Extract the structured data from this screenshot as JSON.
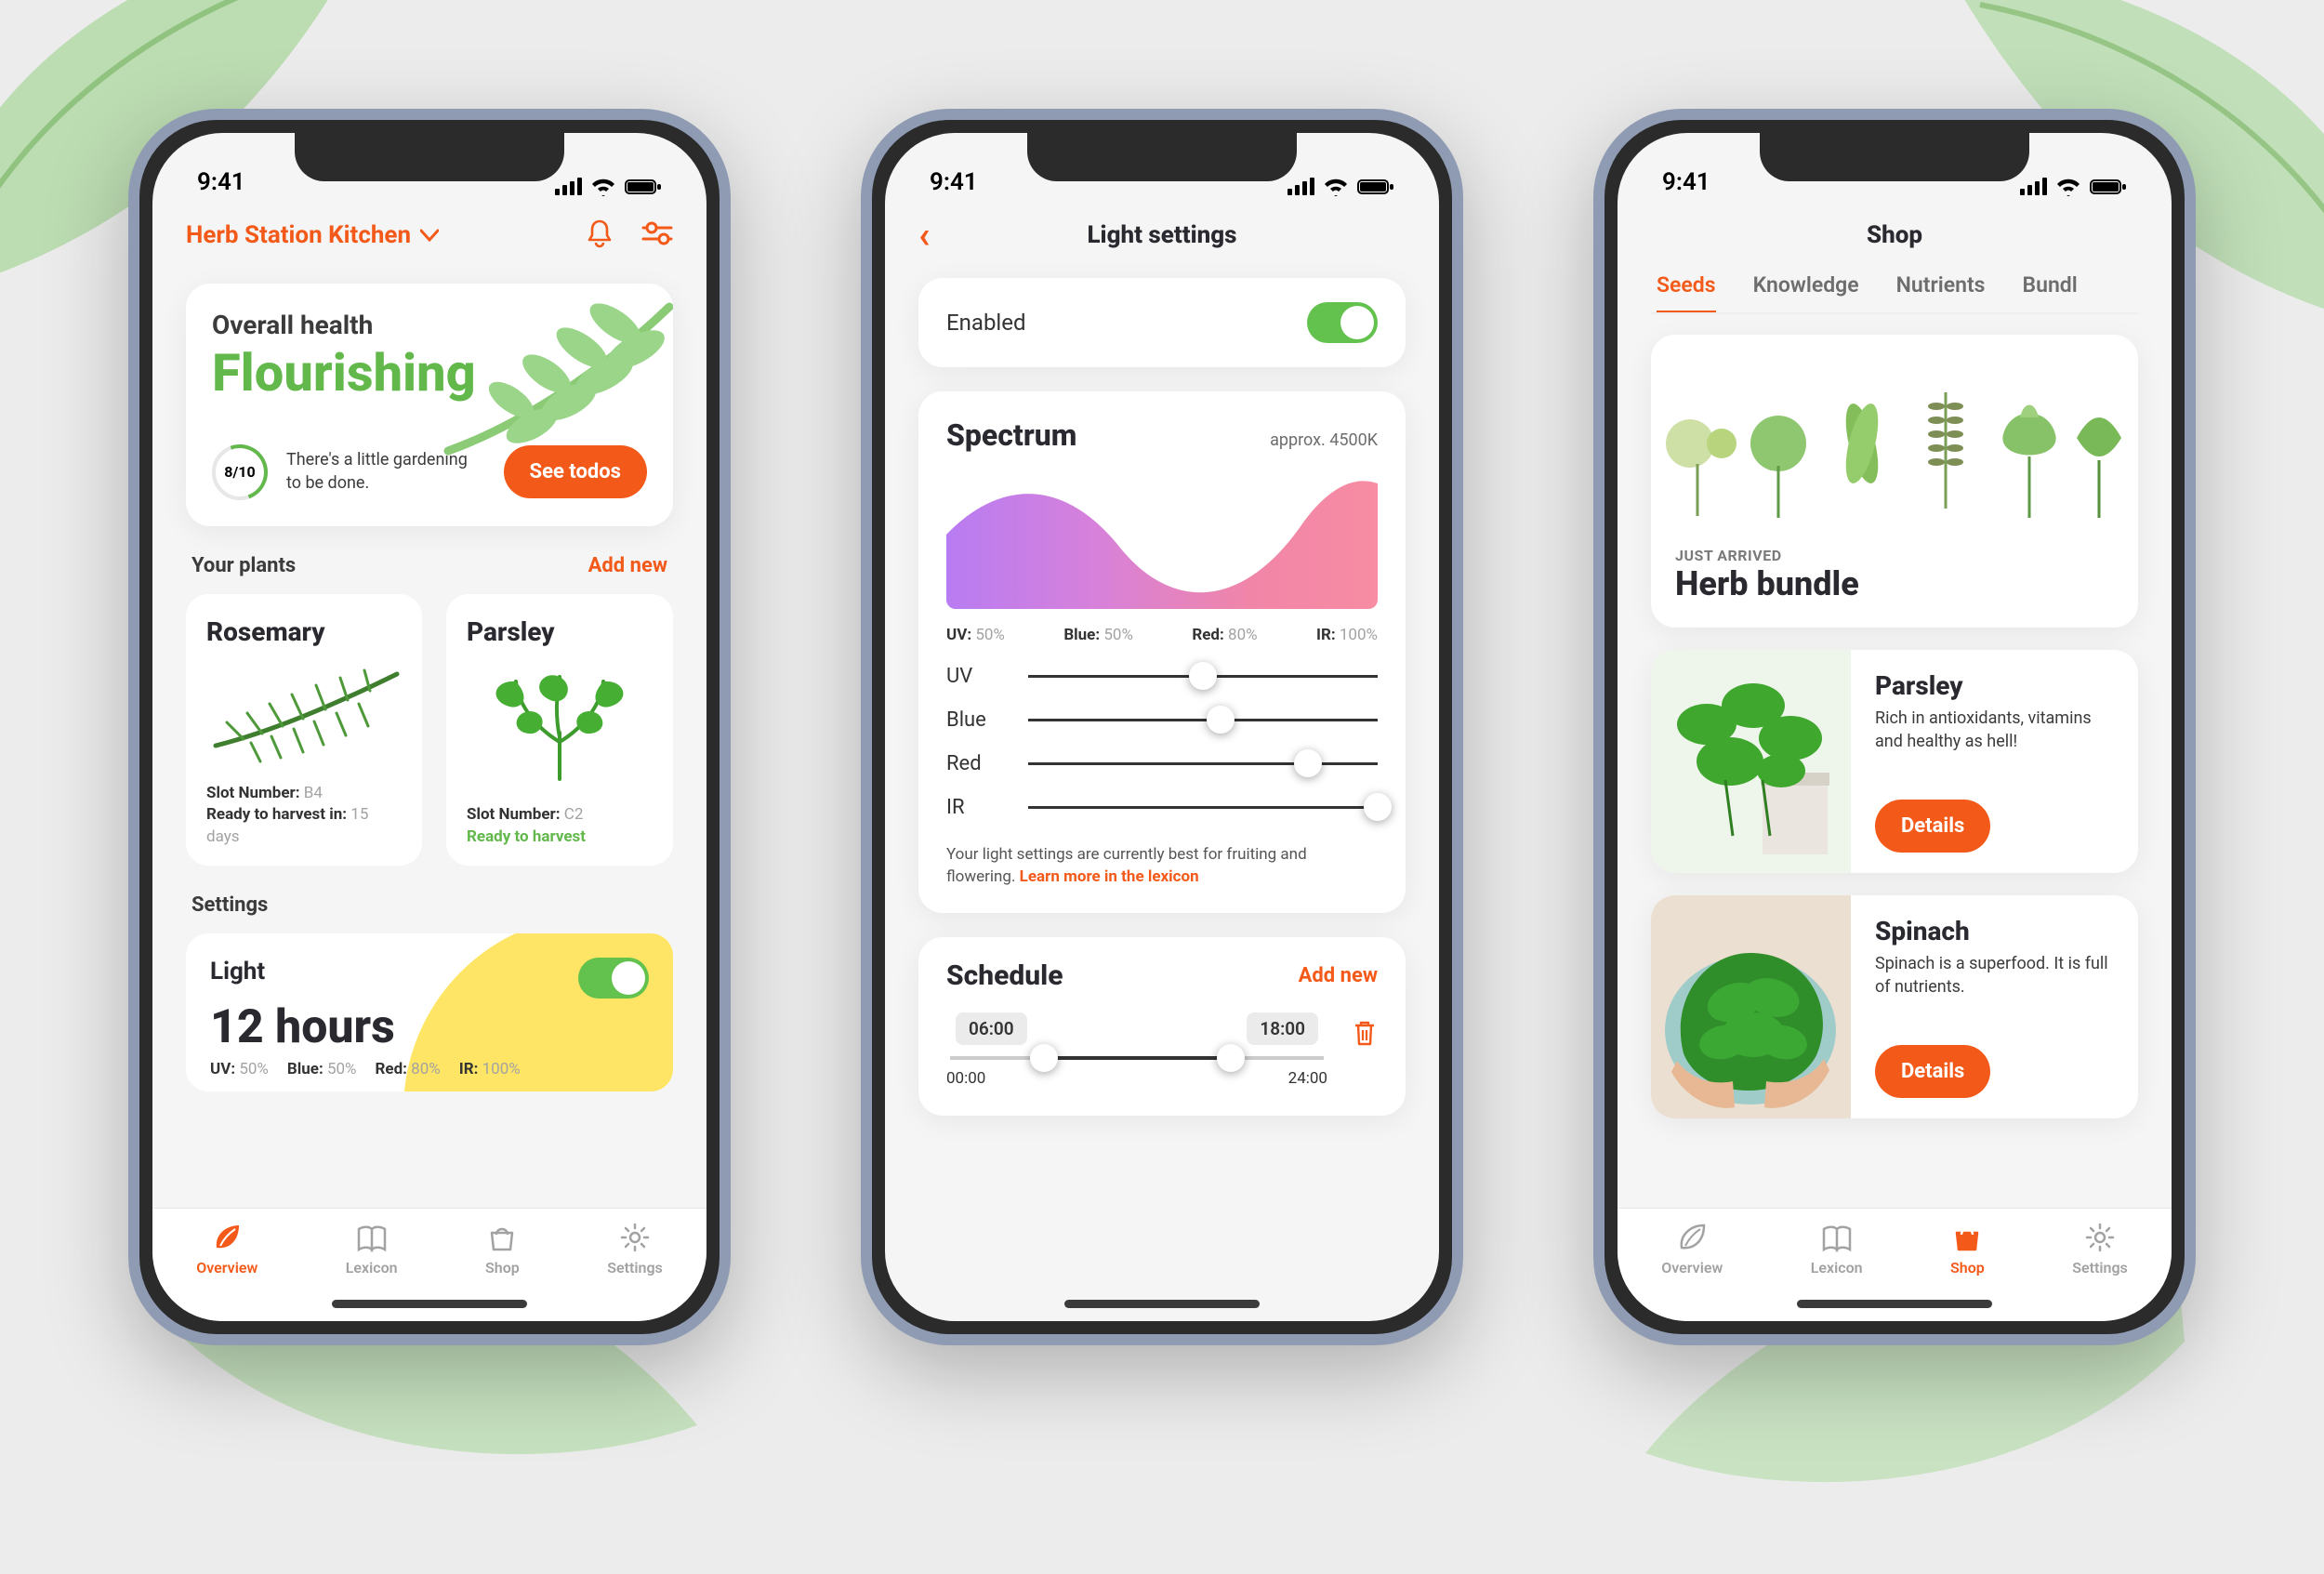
{
  "status": {
    "time": "9:41"
  },
  "screen1": {
    "station_title": "Herb Station Kitchen",
    "health": {
      "label": "Overall health",
      "status": "Flourishing",
      "score": "8/10",
      "tip": "There's a little gardening to be done.",
      "cta": "See todos"
    },
    "plants_section": {
      "title": "Your plants",
      "link": "Add new"
    },
    "plants": [
      {
        "name": "Rosemary",
        "slot_label": "Slot Number:",
        "slot_value": "B4",
        "harvest_label": "Ready to harvest in:",
        "harvest_value": "15 days"
      },
      {
        "name": "Parsley",
        "slot_label": "Slot Number:",
        "slot_value": "C2",
        "ready_text": "Ready to harvest"
      }
    ],
    "settings_title": "Settings",
    "light": {
      "label": "Light",
      "value": "12 hours",
      "readout": [
        {
          "name": "UV:",
          "val": "50%"
        },
        {
          "name": "Blue:",
          "val": "50%"
        },
        {
          "name": "Red:",
          "val": "80%"
        },
        {
          "name": "IR:",
          "val": "100%"
        }
      ]
    }
  },
  "screen2": {
    "title": "Light settings",
    "enabled_label": "Enabled",
    "spectrum": {
      "title": "Spectrum",
      "approx": "approx. 4500K",
      "readout": [
        {
          "name": "UV:",
          "val": "50%"
        },
        {
          "name": "Blue:",
          "val": "50%"
        },
        {
          "name": "Red:",
          "val": "80%"
        },
        {
          "name": "IR:",
          "val": "100%"
        }
      ],
      "sliders": [
        {
          "label": "UV",
          "pct": 50
        },
        {
          "label": "Blue",
          "pct": 55
        },
        {
          "label": "Red",
          "pct": 80
        },
        {
          "label": "IR",
          "pct": 100
        }
      ],
      "hint_text": "Your light settings are currently best for fruiting and flowering. ",
      "hint_link": "Learn more in the lexicon"
    },
    "schedule": {
      "title": "Schedule",
      "add_link": "Add new",
      "start_chip": "06:00",
      "end_chip": "18:00",
      "range_start": "00:00",
      "range_end": "24:00",
      "fill_from_pct": 25,
      "fill_to_pct": 75
    }
  },
  "screen3": {
    "title": "Shop",
    "tabs": [
      "Seeds",
      "Knowledge",
      "Nutrients",
      "Bundl"
    ],
    "hero": {
      "kicker": "JUST ARRIVED",
      "title": "Herb bundle"
    },
    "products": [
      {
        "name": "Parsley",
        "desc": "Rich in antioxidants, vitamins and healthy as hell!",
        "cta": "Details"
      },
      {
        "name": "Spinach",
        "desc": "Spinach is a superfood. It is full of nutrients.",
        "cta": "Details"
      }
    ]
  },
  "tabbar": {
    "overview": "Overview",
    "lexicon": "Lexicon",
    "shop": "Shop",
    "settings": "Settings"
  }
}
